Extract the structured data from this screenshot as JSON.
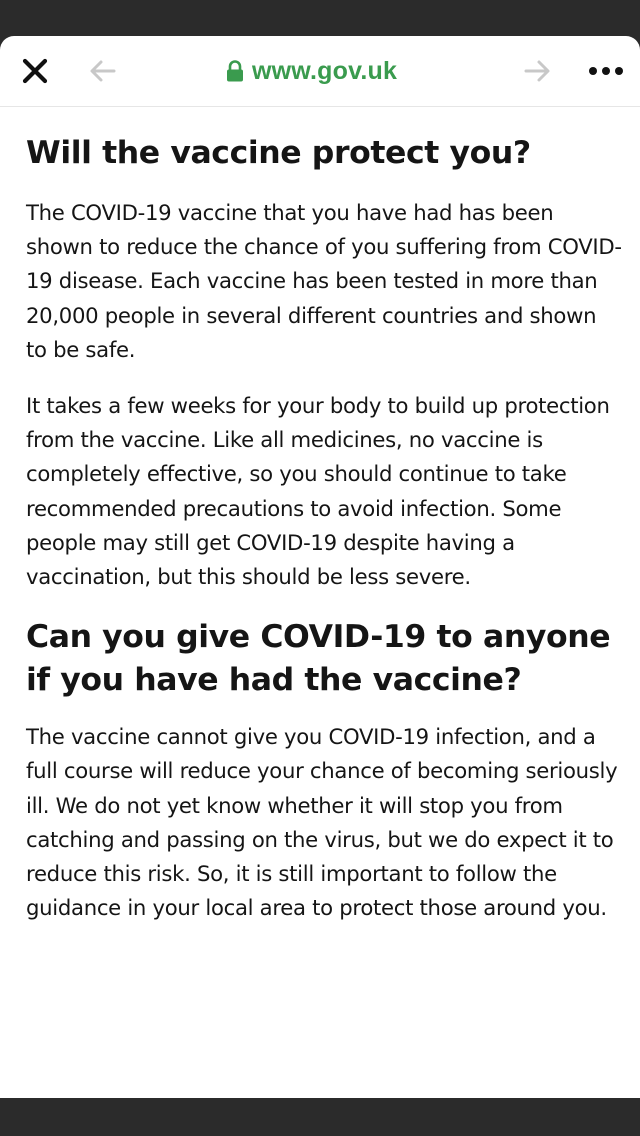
{
  "browser": {
    "url": "www.gov.uk",
    "icons": {
      "close": "close-icon",
      "back": "arrow-left-icon",
      "lock": "lock-icon",
      "forward": "arrow-right-icon",
      "more": "more-horizontal-icon"
    },
    "colors": {
      "url": "#3a9b4e",
      "nav_disabled": "#c8c8c8"
    }
  },
  "article": {
    "sections": [
      {
        "heading": "Will the vaccine protect you?",
        "paragraphs": [
          "The COVID-19 vaccine that you have had has been shown to reduce the chance of you suffering from COVID-19 disease. Each vaccine has been tested in more than 20,000 people in several different countries and shown to be safe.",
          "It takes a few weeks for your body to build up protection from the vaccine. Like all medicines, no vaccine is completely effective, so you should continue to take recommended precautions to avoid infection. Some people may still get COVID-19 despite having a vaccination, but this should be less severe."
        ]
      },
      {
        "heading": "Can you give COVID-19 to anyone if you have had the vaccine?",
        "paragraphs": [
          "The vaccine cannot give you COVID-19 infection, and a full course will reduce your chance of becoming seriously ill. We do not yet know whether it will stop you from catching and passing on the virus, but we do expect it to reduce this risk. So, it is still important to follow the guidance in your local area to protect those around you."
        ]
      }
    ]
  }
}
